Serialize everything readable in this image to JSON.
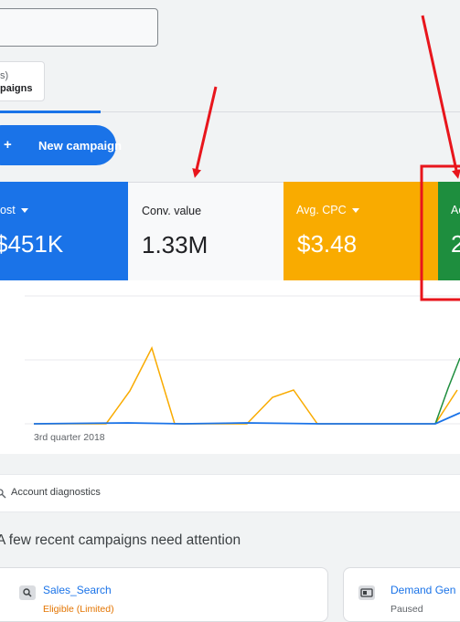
{
  "header": {
    "search_value": ""
  },
  "tab": {
    "sub_label": "s)",
    "main_label": "paigns"
  },
  "actions": {
    "new_campaign_label": "New campaign",
    "new_campaign_icon": "plus-icon"
  },
  "metrics": [
    {
      "label": "ost",
      "value": "$451K",
      "color": "#1a73e8",
      "has_dropdown": true
    },
    {
      "label": "Conv. value",
      "value": "1.33M",
      "color": "#f8f9fa",
      "has_dropdown": false
    },
    {
      "label": "Avg. CPC",
      "value": "$3.48",
      "color": "#f9ab00",
      "has_dropdown": true
    },
    {
      "label": "Ac",
      "value": "2",
      "color": "#1e8e3e",
      "has_dropdown": false
    }
  ],
  "chart": {
    "x_label": "3rd quarter 2018"
  },
  "diagnostics": {
    "label": "Account diagnostics",
    "icon": "search-icon"
  },
  "attention": {
    "heading": "A few recent campaigns need attention"
  },
  "campaigns": [
    {
      "name": "Sales_Search",
      "status": "Eligible (Limited)",
      "status_color": "#e37400",
      "icon": "search-campaign-icon"
    },
    {
      "name": "Demand Gen",
      "status": "Paused",
      "status_color": "#5f6368",
      "icon": "demand-gen-icon"
    }
  ],
  "colors": {
    "accent": "#1a73e8",
    "cost": "#1a73e8",
    "cpc": "#f9ab00",
    "accounts": "#1e8e3e",
    "annotation": "#e8151c"
  }
}
